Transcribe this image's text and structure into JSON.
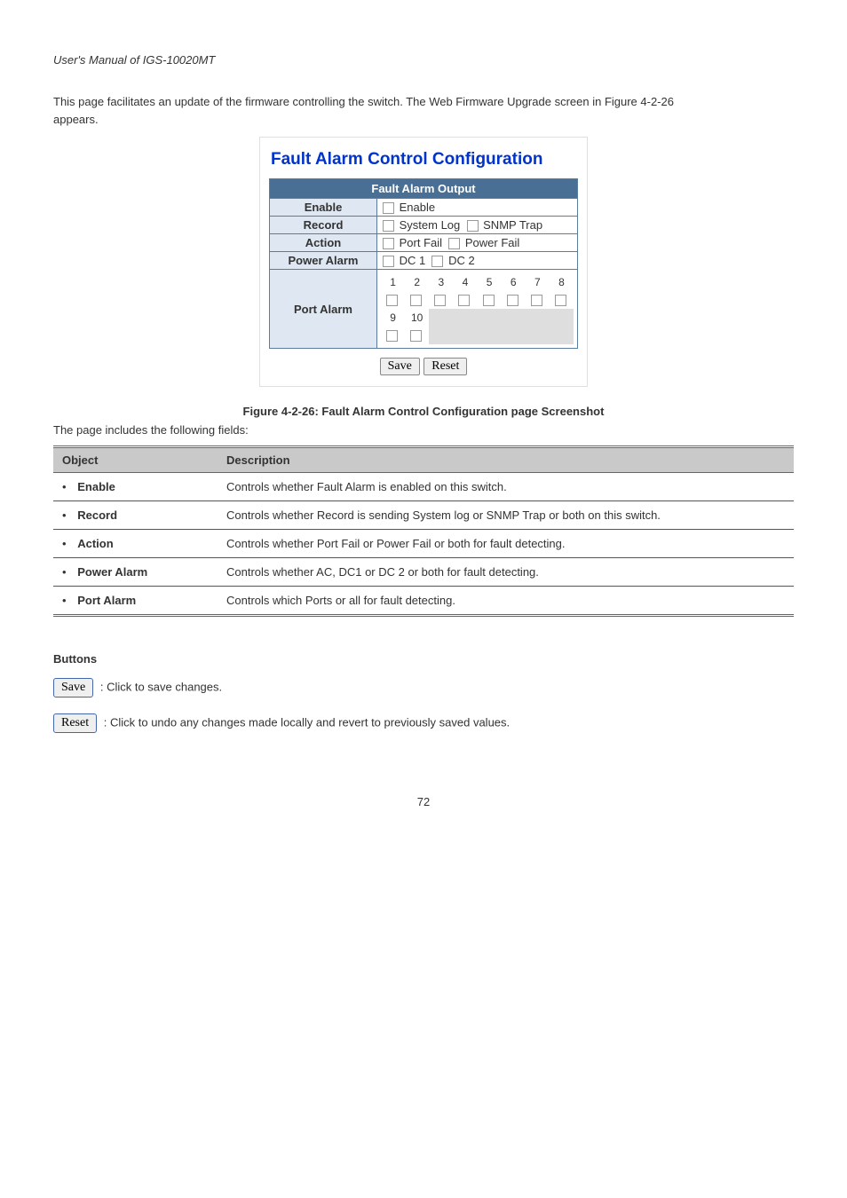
{
  "header": {
    "left": "User's Manual of IGS-10020MT",
    "right": ""
  },
  "intro": {
    "line1_prefix": "This page facilitates an update of the firmware controlling the switch. The Web Firmware Upgrade screen in ",
    "line1_figref": "Figure 4-2-26",
    "line2": "appears."
  },
  "panel": {
    "title": "Fault Alarm Control Configuration",
    "tableHeader": "Fault Alarm Output",
    "rows": {
      "enable": {
        "label": "Enable",
        "opt": "Enable"
      },
      "record": {
        "label": "Record",
        "opt1": "System Log",
        "opt2": "SNMP Trap"
      },
      "action": {
        "label": "Action",
        "opt1": "Port Fail",
        "opt2": "Power Fail"
      },
      "power": {
        "label": "Power Alarm",
        "opt1": "DC 1",
        "opt2": "DC 2"
      },
      "port": {
        "label": "Port Alarm",
        "nums": [
          "1",
          "2",
          "3",
          "4",
          "5",
          "6",
          "7",
          "8",
          "9",
          "10"
        ]
      }
    },
    "buttons": {
      "save": "Save",
      "reset": "Reset"
    }
  },
  "figure": {
    "caption": "Figure 4-2-26: Fault Alarm Control Configuration page Screenshot",
    "note": "The page includes the following fields:"
  },
  "descTable": {
    "head": {
      "object": "Object",
      "description": "Description"
    },
    "rows": [
      {
        "obj": "Enable",
        "desc": "Controls whether Fault Alarm is enabled on this switch."
      },
      {
        "obj": "Record",
        "desc": "Controls whether Record is sending System log or SNMP Trap or both on this switch."
      },
      {
        "obj": "Action",
        "desc": "Controls whether Port Fail or Power Fail or both for fault detecting."
      },
      {
        "obj": "Power Alarm",
        "desc": "Controls whether AC, DC1 or DC 2 or both for fault detecting."
      },
      {
        "obj": "Port Alarm",
        "desc": "Controls which Ports or all for fault detecting."
      }
    ]
  },
  "buttonsSection": {
    "heading": "Buttons",
    "save": {
      "label": "Save",
      "desc": ": Click to save changes."
    },
    "reset": {
      "label": "Reset",
      "desc": ": Click to undo any changes made locally and revert to previously saved values."
    }
  },
  "footer": {
    "page": "72"
  }
}
